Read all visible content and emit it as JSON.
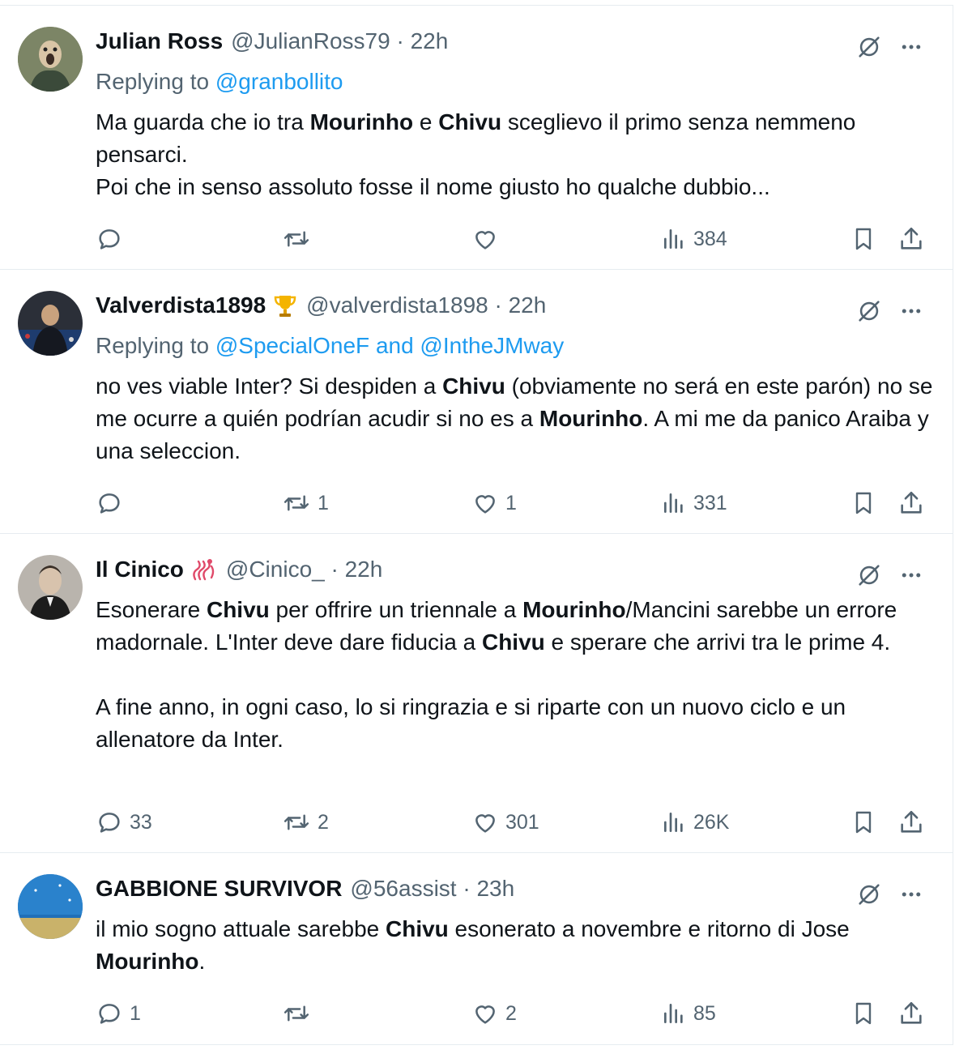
{
  "tweets": [
    {
      "name": "Julian Ross",
      "handle": "@JulianRoss79 · 22h",
      "reply_prefix": "Replying to",
      "reply_to": "@granbollito",
      "text": [
        [
          "Ma guarda che io tra ",
          "Mourinho",
          " e ",
          "Chivu",
          " sceglievo il primo senza nemmeno pensarci."
        ],
        [
          "Poi che in senso assoluto fosse il nome giusto ho qualche dubbio..."
        ]
      ],
      "replies": "",
      "reposts": "",
      "likes": "",
      "views": "384"
    },
    {
      "name": "Valverdista1898",
      "badge": "trophy-emoji",
      "handle": "@valverdista1898 · 22h",
      "reply_prefix": "Replying to",
      "reply_to": "@SpecialOneF and @IntheJMway",
      "text": [
        [
          "no ves viable Inter? Si despiden a ",
          "Chivu",
          " (obviamente no será en este parón) no se me ocurre a quién podrían acudir si no es a ",
          "Mourinho",
          ". A mi me da panico Araiba y una seleccion."
        ]
      ],
      "replies": "",
      "reposts": "1",
      "likes": "1",
      "views": "331"
    },
    {
      "name": "Il Cinico",
      "badge": "snake-emoji",
      "handle": "@Cinico_ · 22h",
      "text": [
        [
          "Esonerare ",
          "Chivu",
          " per offrire un triennale a ",
          "Mourinho",
          "/Mancini sarebbe un errore madornale. L'Inter deve dare fiducia a ",
          "Chivu",
          " e sperare che arrivi tra le prime 4."
        ],
        [],
        [
          "A fine anno, in ogni caso, lo si ringrazia e si riparte con un nuovo ciclo e un allenatore da Inter."
        ]
      ],
      "replies": "33",
      "reposts": "2",
      "likes": "301",
      "views": "26K"
    },
    {
      "name": "GABBIONE SURVIVOR",
      "handle": "@56assist · 23h",
      "text": [
        [
          "il mio sogno attuale sarebbe ",
          "Chivu",
          " esonerato a novembre e ritorno di Jose ",
          "Mourinho",
          "."
        ]
      ],
      "replies": "1",
      "reposts": "",
      "likes": "2",
      "views": "85"
    }
  ],
  "icons": {
    "reply": "reply-icon",
    "repost": "repost-icon",
    "like": "heart-icon",
    "views": "views-icon",
    "bookmark": "bookmark-icon",
    "share": "share-icon",
    "grok": "grok-icon",
    "more": "more-icon"
  },
  "colors": {
    "text": "#0f1419",
    "secondary": "#536471",
    "link": "#1d9bf0",
    "divider": "#e6ecf0"
  }
}
